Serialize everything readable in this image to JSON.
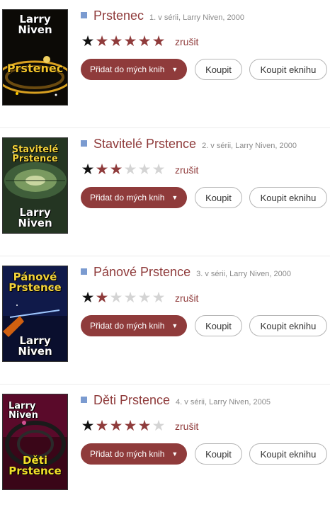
{
  "colors": {
    "accent": "#8f3b3b",
    "square": "#7b9bd0",
    "star_empty": "#d4d4d4",
    "star_dark": "#111111"
  },
  "books": [
    {
      "title": "Prstenec",
      "meta": "1. v sérii, Larry Niven, 2000",
      "rating": 6,
      "cancel_label": "zrušit",
      "add_label": "Přidat do mých knih",
      "buy_label": "Koupit",
      "ebook_label": "Koupit eknihu",
      "cover": {
        "author": "Larry Niven",
        "title": "Prstenec"
      }
    },
    {
      "title": "Stavitelé Prstence",
      "meta": "2. v sérii, Larry Niven, 2000",
      "rating": 3,
      "cancel_label": "zrušit",
      "add_label": "Přidat do mých knih",
      "buy_label": "Koupit",
      "ebook_label": "Koupit eknihu",
      "cover": {
        "author": "Larry Niven",
        "title": "Stavitelé Prstence"
      }
    },
    {
      "title": "Pánové Prstence",
      "meta": "3. v sérii, Larry Niven, 2000",
      "rating": 2,
      "cancel_label": "zrušit",
      "add_label": "Přidat do mých knih",
      "buy_label": "Koupit",
      "ebook_label": "Koupit eknihu",
      "cover": {
        "author": "Larry Niven",
        "title": "Pánové Prstence"
      }
    },
    {
      "title": "Děti Prstence",
      "meta": "4. v sérii, Larry Niven, 2005",
      "rating": 5,
      "cancel_label": "zrušit",
      "add_label": "Přidat do mých knih",
      "buy_label": "Koupit",
      "ebook_label": "Koupit eknihu",
      "cover": {
        "author": "Larry Niven",
        "title": "Děti Prstence"
      }
    }
  ]
}
